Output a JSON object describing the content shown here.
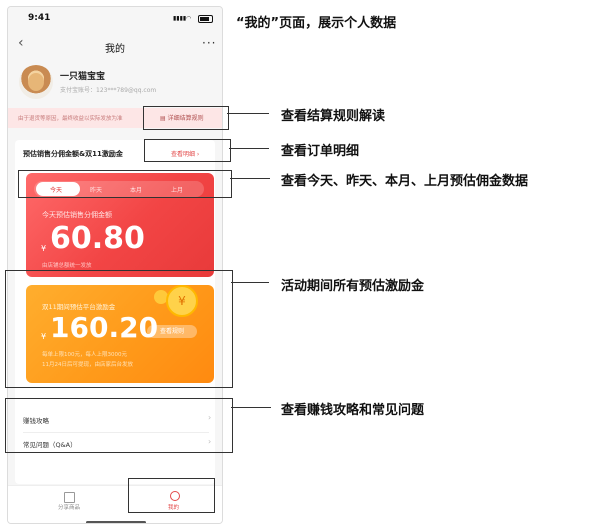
{
  "status": {
    "time": "9:41",
    "signal": "▮▮▮▮"
  },
  "nav": {
    "back": "‹",
    "title": "我的",
    "more": "···"
  },
  "user": {
    "name": "一只猫宝宝",
    "account": "支付宝账号：123***789@qq.com"
  },
  "notice": {
    "text": "由于退货等原因，最终收益以实际发放为准",
    "rule_link": "详细结算规则"
  },
  "estimate": {
    "title": "预估销售分佣金额&双11激励金",
    "detail_link": "查看明细 ›",
    "tabs": [
      "今天",
      "昨天",
      "本月",
      "上月"
    ],
    "active_tab": "今天",
    "red_card": {
      "label": "今天预估销售分佣金额",
      "currency": "¥",
      "amount": "60.80",
      "note": "由店铺总额统一发放"
    },
    "orange_card": {
      "label": "双11期间预估平台激励金",
      "currency": "¥",
      "amount": "160.20",
      "button": "查看规则",
      "note1": "每单上限100元，每人上限3000元",
      "note2": "11月24日后可提现，由店家后台发放"
    }
  },
  "list": [
    "赚钱攻略",
    "常见问题（Q&A）"
  ],
  "tabbar": [
    "分享商品",
    "我的"
  ],
  "annotations": {
    "page_title": "“我的”页面，展示个人数据",
    "rule": "查看结算规则解读",
    "order": "查看订单明细",
    "period": "查看今天、昨天、本月、上月预估佣金数据",
    "incentive": "活动期间所有预估激励金",
    "faq": "查看赚钱攻略和常见问题"
  },
  "colors": {
    "red": "#f24545",
    "orange": "#ff9a1a",
    "accent": "#e34a4a"
  }
}
